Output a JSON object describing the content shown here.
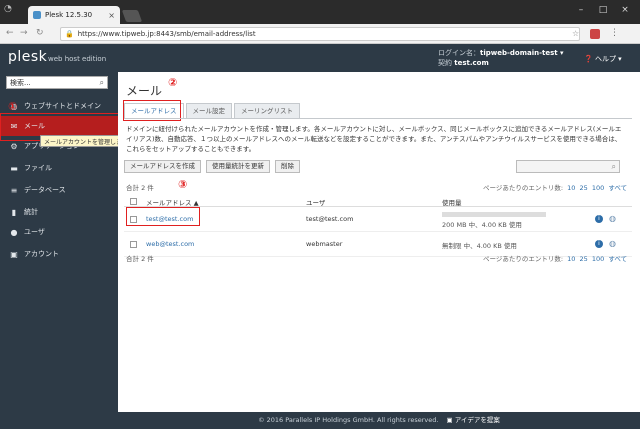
{
  "browser": {
    "tab_title": "Plesk 12.5.30",
    "tab_close": "×",
    "url": "https://www.tipweb.jp:8443/smb/email-address/list",
    "window_buttons": [
      "–",
      "□",
      "×"
    ]
  },
  "header": {
    "logo": "plesk",
    "edition": "web host edition",
    "login_label": "ログイン名：",
    "login_value": "tipweb-domain-test ▾",
    "subscription_label": "契約",
    "subscription_value": "test.com",
    "help": "ヘルプ ▾"
  },
  "sidebar": {
    "search_placeholder": "検索...",
    "items": [
      {
        "label": "ウェブサイトとドメイン",
        "icon": "globe"
      },
      {
        "label": "メール",
        "icon": "mail"
      },
      {
        "label": "アプリケーション",
        "icon": "gear"
      },
      {
        "label": "ファイル",
        "icon": "folder"
      },
      {
        "label": "データベース",
        "icon": "database"
      },
      {
        "label": "統計",
        "icon": "chart"
      },
      {
        "label": "ユーザ",
        "icon": "user"
      },
      {
        "label": "アカウント",
        "icon": "account"
      }
    ],
    "tooltip": "メールアカウントを管理します"
  },
  "annotations": {
    "one": "①",
    "two": "②",
    "three": "③"
  },
  "main": {
    "title": "メール",
    "tabs": [
      "メールアドレス",
      "メール設定",
      "メーリングリスト"
    ],
    "description": "ドメインに紐付けられたメールアカウントを作成・管理します。各メールアカウントに対し、メールボックス、同じメールボックスに追加できるメールアドレス(メールエイリアス)数、自動応答、１つ以上のメールアドレスへのメール転送などを設定することができます。また、アンチスパムやアンチウイルスサービスを使用できる場合は、これらをセットアップすることもできます。",
    "actions": [
      "メールアドレスを作成",
      "使用量統計を更新",
      "削除"
    ],
    "total": "合計 2 件",
    "perpage_label": "ページあたりのエントリ数:",
    "perpage_options": [
      "10",
      "25",
      "100",
      "すべて"
    ],
    "columns": [
      "メールアドレス ▲",
      "ユーザ",
      "使用量"
    ],
    "rows": [
      {
        "email": "test@test.com",
        "user": "test@test.com",
        "usage": "200 MB 中、4.00 KB 使用"
      },
      {
        "email": "web@test.com",
        "user": "webmaster",
        "usage": "無制限 中、4.00 KB 使用"
      }
    ]
  },
  "footer": {
    "copyright": "© 2016 Parallels IP Holdings GmbH. All rights reserved.",
    "idea": "アイデアを提案"
  },
  "colors": {
    "header": "#2d3a46",
    "active": "#b51e1e",
    "link": "#2d6da8",
    "annotation": "#e02020"
  }
}
